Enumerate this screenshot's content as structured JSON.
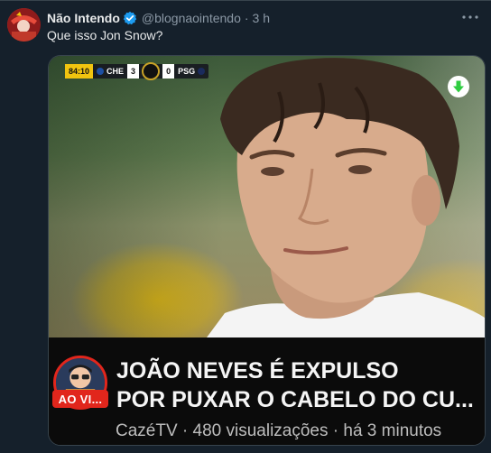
{
  "tweet": {
    "author_name": "Não Intendo",
    "handle": "@blognaointendo",
    "separator": "·",
    "time": "3 h",
    "text": "Que isso Jon Snow?"
  },
  "scoreboard": {
    "clock": "84:10",
    "home_team": "CHE",
    "home_score": "3",
    "away_score": "0",
    "away_team": "PSG"
  },
  "video_card": {
    "title_line1": "JOÃO NEVES É EXPULSO",
    "title_line2": "POR PUXAR O CABELO DO CU...",
    "meta": "CazéTV · 480 visualizações · há 3 minutos",
    "live_badge": "AO VI..."
  },
  "icons": {
    "verified": "verified-badge-icon",
    "more": "more-options-icon",
    "download": "download-arrow-icon"
  },
  "colors": {
    "background": "#15202b",
    "text_primary": "#e7e9ea",
    "text_secondary": "#8b98a5",
    "verified_blue": "#1d9bf0",
    "download_green": "#2ecc40",
    "live_red": "#e1261c"
  }
}
